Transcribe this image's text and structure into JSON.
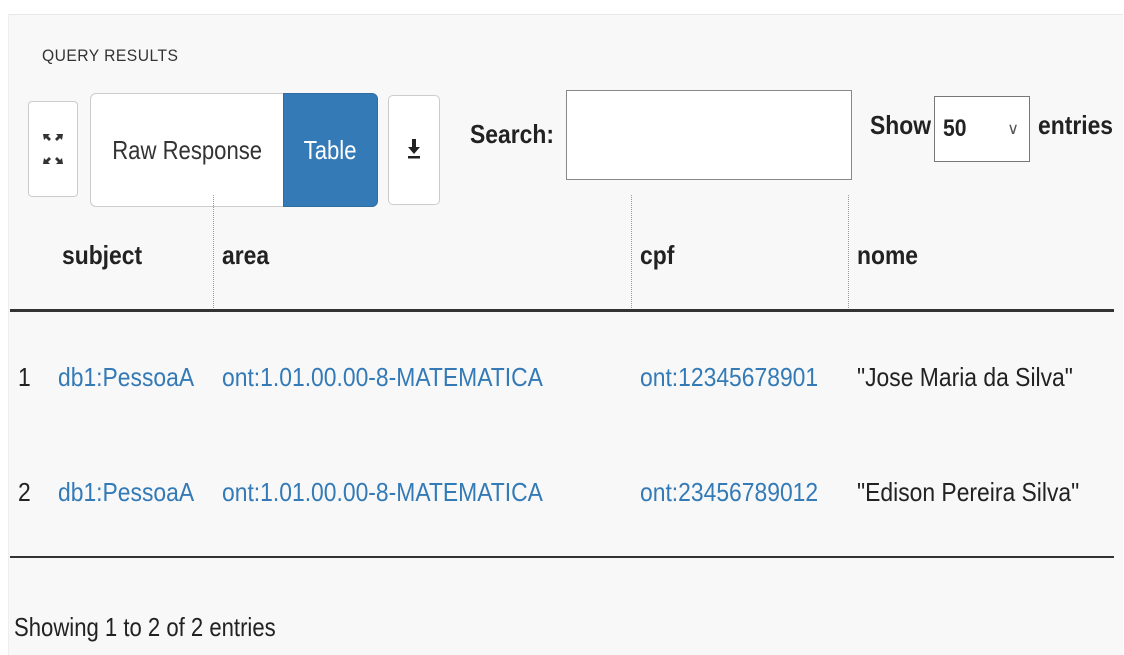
{
  "panel": {
    "section_label": "QUERY RESULTS"
  },
  "toolbar": {
    "fullscreen_icon": "expand-arrows-icon",
    "raw_response_label": "Raw Response",
    "table_label": "Table",
    "active_view": "Table",
    "download_icon": "download-icon",
    "accent_color": "#337ab7"
  },
  "search": {
    "label": "Search:",
    "value": "",
    "placeholder": ""
  },
  "length": {
    "show_label": "Show",
    "selected": "50",
    "entries_label": "entries"
  },
  "table": {
    "columns": [
      "subject",
      "area",
      "cpf",
      "nome"
    ],
    "rows": [
      {
        "index": "1",
        "subject": "db1:PessoaA",
        "area": "ont:1.01.00.00-8-MATEMATICA",
        "cpf": "ont:12345678901",
        "nome": "\"Jose Maria da Silva\""
      },
      {
        "index": "2",
        "subject": "db1:PessoaA",
        "area": "ont:1.01.00.00-8-MATEMATICA",
        "cpf": "ont:23456789012",
        "nome": "\"Edison Pereira Silva\""
      }
    ]
  },
  "footer": {
    "info": "Showing 1 to 2 of 2 entries"
  }
}
